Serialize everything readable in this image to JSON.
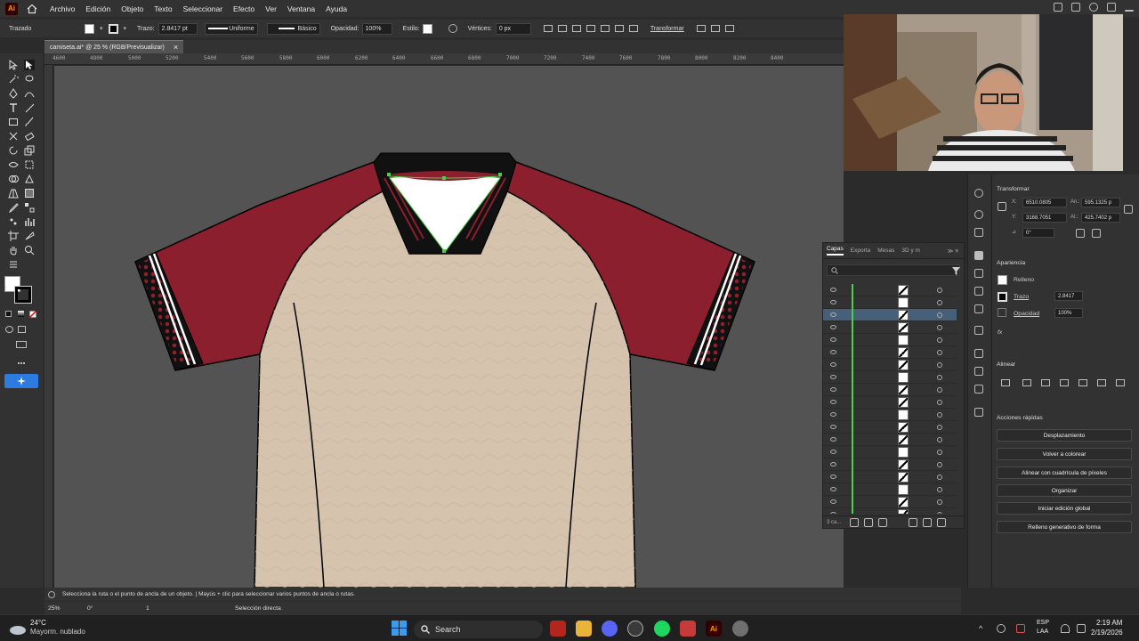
{
  "app": {
    "logo": "Ai",
    "menu": [
      "Archivo",
      "Edición",
      "Objeto",
      "Texto",
      "Seleccionar",
      "Efecto",
      "Ver",
      "Ventana",
      "Ayuda"
    ]
  },
  "control": {
    "mode_label": "Trazado",
    "stroke_label": "Trazo:",
    "stroke_value": "2.8417 pt",
    "profile_label": "Uniforme",
    "brush_label": "Básico",
    "opacity_label": "Opacidad:",
    "opacity_value": "100%",
    "style_label": "Estilo:",
    "vertices_label": "Vértices:",
    "vertices_value": "0 px",
    "transform_label": "Transformar"
  },
  "document": {
    "tab_title": "camiseta.ai* @ 25 % (RGB/Previsualizar)",
    "close_symbol": "×",
    "ruler_ticks": [
      "4600",
      "4800",
      "5000",
      "5200",
      "5400",
      "5600",
      "5800",
      "6000",
      "6200",
      "6400",
      "6600",
      "6800",
      "7000",
      "7200",
      "7400",
      "7600",
      "7800",
      "8000",
      "8200",
      "8400"
    ]
  },
  "layers": {
    "tabs": [
      "Capas",
      "Exporta",
      "Mesas",
      "3D y m"
    ],
    "footer_count": "3 ca...",
    "rows": 19,
    "selected_row": 2
  },
  "transform": {
    "title": "Transformar",
    "x_label": "X:",
    "x_value": "6510.0805",
    "y_label": "Y:",
    "y_value": "3168.7051",
    "w_label": "An.:",
    "w_value": "595.1325 p",
    "h_label": "Al.:",
    "h_value": "425.7402 p",
    "angle_value": "0°"
  },
  "appearance": {
    "title": "Apariencia",
    "fill_label": "Relleno",
    "stroke_label": "Trazo",
    "stroke_value": "2.8417",
    "opacity_label": "Opacidad",
    "opacity_value": "100%",
    "fx": "fx"
  },
  "align": {
    "title": "Alinear"
  },
  "quick_actions": {
    "title": "Acciones rápidas",
    "buttons": [
      "Desplazamiento",
      "Volver a colorear",
      "Alinear con cuadrícula de píxeles",
      "Organizar",
      "Iniciar edición global",
      "Relleno generativo de forma"
    ]
  },
  "status": {
    "hint": "Selecciona la ruta o el punto de ancla de un objeto.  |  Mayús + clic para seleccionar varios puntos de ancla o rutas.",
    "zoom": "25%",
    "rotation": "0°",
    "artboard": "1",
    "tool_name": "Selección directa"
  },
  "taskbar": {
    "weather_temp": "24°C",
    "weather_desc": "Mayorm. nublado",
    "search_label": "Search",
    "lang_top": "ESP",
    "lang_bottom": "LAA",
    "time": "2:19 AM",
    "date": "2/19/2026"
  },
  "colors": {
    "sleeve_red": "#8b1f2d",
    "body_beige": "#d5c3ad",
    "canvas_gray": "#535353",
    "panel_dark": "#323232",
    "selection_green": "#4cd04c",
    "accent_blue": "#2d7be0"
  }
}
